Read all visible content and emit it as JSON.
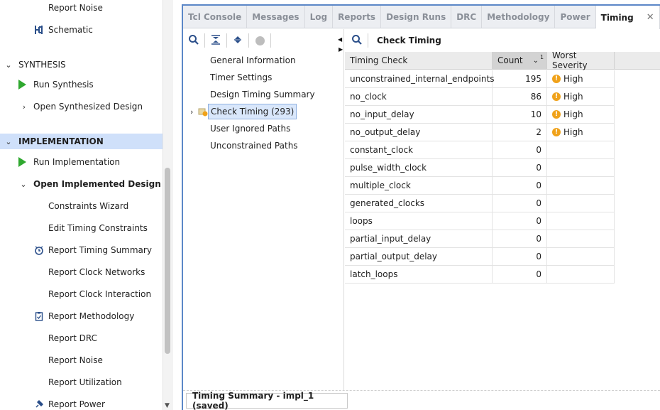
{
  "nav": {
    "items": [
      {
        "label": "Report Noise",
        "kind": "leaf"
      },
      {
        "label": "Schematic",
        "kind": "leaf",
        "icon": "schematic-icon"
      },
      {
        "label": "SYNTHESIS",
        "kind": "section"
      },
      {
        "label": "Run Synthesis",
        "kind": "run"
      },
      {
        "label": "Open Synthesized Design",
        "kind": "expand"
      },
      {
        "label": "IMPLEMENTATION",
        "kind": "section-selected"
      },
      {
        "label": "Run Implementation",
        "kind": "run"
      },
      {
        "label": "Open Implemented Design",
        "kind": "expanded"
      },
      {
        "label": "Constraints Wizard",
        "kind": "leaf"
      },
      {
        "label": "Edit Timing Constraints",
        "kind": "leaf"
      },
      {
        "label": "Report Timing Summary",
        "kind": "leaf",
        "icon": "clock-icon"
      },
      {
        "label": "Report Clock Networks",
        "kind": "leaf"
      },
      {
        "label": "Report Clock Interaction",
        "kind": "leaf"
      },
      {
        "label": "Report Methodology",
        "kind": "leaf",
        "icon": "clipboard-icon"
      },
      {
        "label": "Report DRC",
        "kind": "leaf"
      },
      {
        "label": "Report Noise",
        "kind": "leaf"
      },
      {
        "label": "Report Utilization",
        "kind": "leaf"
      },
      {
        "label": "Report Power",
        "kind": "leaf",
        "icon": "power-icon"
      }
    ]
  },
  "tabs": [
    {
      "label": "Tcl Console",
      "active": false
    },
    {
      "label": "Messages",
      "active": false
    },
    {
      "label": "Log",
      "active": false
    },
    {
      "label": "Reports",
      "active": false
    },
    {
      "label": "Design Runs",
      "active": false
    },
    {
      "label": "DRC",
      "active": false
    },
    {
      "label": "Methodology",
      "active": false
    },
    {
      "label": "Power",
      "active": false
    },
    {
      "label": "Timing",
      "active": true
    }
  ],
  "tree": {
    "items": [
      {
        "label": "General Information"
      },
      {
        "label": "Timer Settings"
      },
      {
        "label": "Design Timing Summary"
      },
      {
        "label": "Check Timing (293)",
        "selected": true
      },
      {
        "label": "User Ignored Paths"
      },
      {
        "label": "Unconstrained Paths"
      }
    ]
  },
  "right": {
    "title": "Check Timing"
  },
  "table": {
    "headers": {
      "check": "Timing Check",
      "count": "Count",
      "sort_rank": "1",
      "severity": "Worst Severity"
    },
    "rows": [
      {
        "check": "unconstrained_internal_endpoints",
        "count": "195",
        "severity": "High"
      },
      {
        "check": "no_clock",
        "count": "86",
        "severity": "High"
      },
      {
        "check": "no_input_delay",
        "count": "10",
        "severity": "High"
      },
      {
        "check": "no_output_delay",
        "count": "2",
        "severity": "High"
      },
      {
        "check": "constant_clock",
        "count": "0",
        "severity": ""
      },
      {
        "check": "pulse_width_clock",
        "count": "0",
        "severity": ""
      },
      {
        "check": "multiple_clock",
        "count": "0",
        "severity": ""
      },
      {
        "check": "generated_clocks",
        "count": "0",
        "severity": ""
      },
      {
        "check": "loops",
        "count": "0",
        "severity": ""
      },
      {
        "check": "partial_input_delay",
        "count": "0",
        "severity": ""
      },
      {
        "check": "partial_output_delay",
        "count": "0",
        "severity": ""
      },
      {
        "check": "latch_loops",
        "count": "0",
        "severity": ""
      }
    ]
  },
  "bottom_tab": "Timing Summary - impl_1 (saved)",
  "colors": {
    "accent": "#5b87c7",
    "run": "#2fa82f",
    "warning": "#f0a21a",
    "selection": "#cfe0fa"
  }
}
